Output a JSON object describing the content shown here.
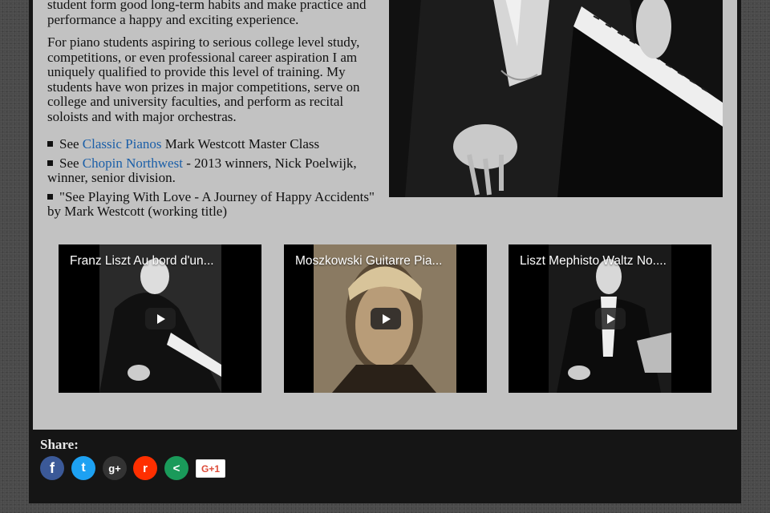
{
  "content": {
    "paragraph1": "student form good long-term habits and make practice and performance a happy and exciting experience.",
    "paragraph2": "For piano students aspiring to serious college level study, competitions, or even professional career aspiration I am uniquely qualified to provide this level of training. My students have won prizes in major competitions, serve on college and university faculties, and perform as recital soloists and with major orchestras.",
    "bullets": [
      {
        "prefix": "See ",
        "link": "Classic Pianos",
        "suffix": " Mark Westcott Master Class"
      },
      {
        "prefix": "See ",
        "link": "Chopin Northwest",
        "suffix": " - 2013 winners, Nick Poelwijk, winner, senior division."
      },
      {
        "prefix": "\"See Playing With Love - A Journey of Happy Accidents\" by Mark Westcott (working title)",
        "link": "",
        "suffix": ""
      }
    ]
  },
  "videos": [
    {
      "title": "Franz Liszt Au bord d'un..."
    },
    {
      "title": "Moszkowski Guitarre Pia..."
    },
    {
      "title": "Liszt Mephisto Waltz No...."
    }
  ],
  "share": {
    "label": "Share:",
    "buttons": [
      {
        "name": "facebook",
        "glyph": "f",
        "color": "#3b5998"
      },
      {
        "name": "twitter",
        "glyph": "t",
        "color": "#1da1f2"
      },
      {
        "name": "google-plus",
        "glyph": "g+",
        "color": "#333333"
      },
      {
        "name": "reddit",
        "glyph": "r",
        "color": "#ff2f00"
      },
      {
        "name": "share",
        "glyph": "<",
        "color": "#1a9a5a"
      }
    ],
    "gplus_one": "G+1"
  },
  "colors": {
    "link": "#1b5fa8",
    "content_bg": "#c2c2c2",
    "footer_bg": "#151515"
  }
}
